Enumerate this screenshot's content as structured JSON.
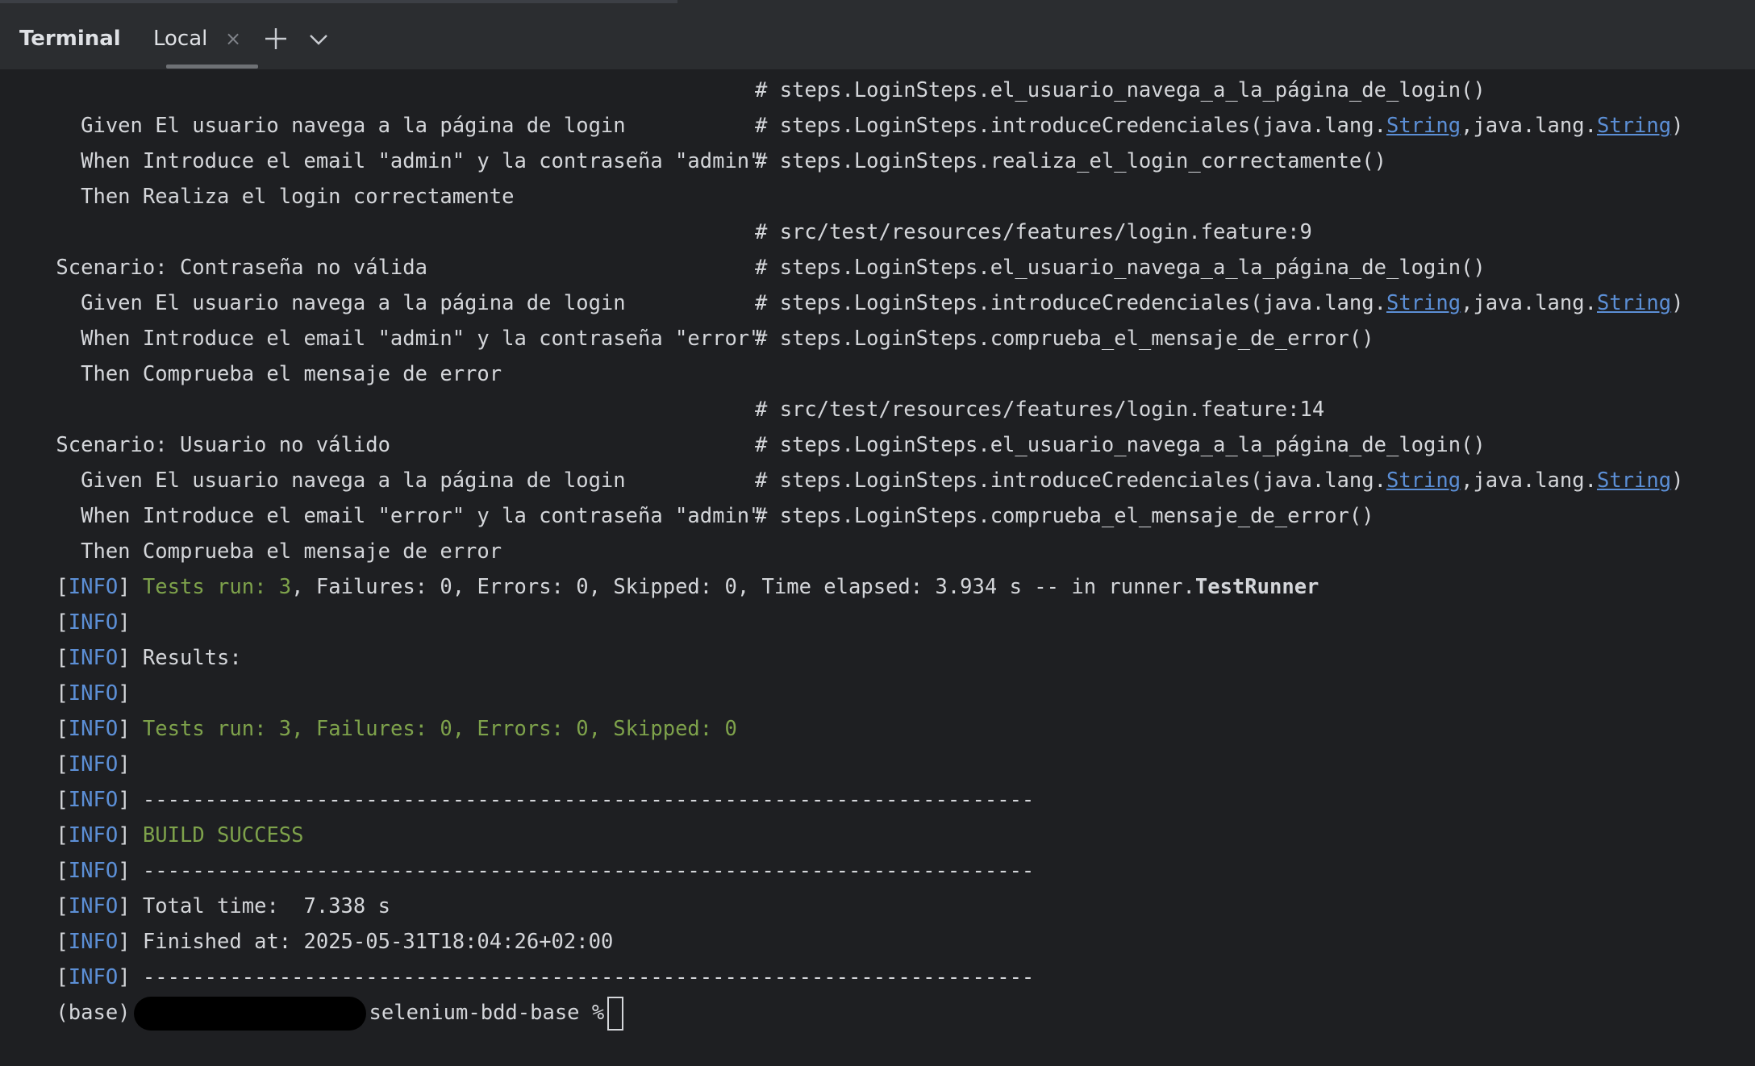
{
  "tabbar": {
    "title": "Terminal",
    "tab_label": "Local",
    "close_glyph": "×",
    "icons": {
      "close": "close-icon",
      "add": "plus-icon",
      "menu": "chevron-down-icon"
    }
  },
  "colors": {
    "green": "#7ea24b",
    "info": "#5c8fd6",
    "text": "#d4d6da",
    "background": "#1e1f22"
  },
  "output": {
    "s1": {
      "given": "  Given El usuario navega a la página de login",
      "given_ref": "# steps.LoginSteps.el_usuario_navega_a_la_página_de_login()",
      "when": "  When Introduce el email \"admin\" y la contraseña \"admin\"",
      "when_ref_pre": "# steps.LoginSteps.introduceCredenciales(java.lang.",
      "when_ref_link1": "String",
      "when_ref_mid": ",java.lang.",
      "when_ref_link2": "String",
      "when_ref_post": ")",
      "then": "  Then Realiza el login correctamente",
      "then_ref": "# steps.LoginSteps.realiza_el_login_correctamente()"
    },
    "s2": {
      "scenario": "Scenario: Contraseña no válida",
      "scenario_ref": "# src/test/resources/features/login.feature:9",
      "given": "  Given El usuario navega a la página de login",
      "given_ref": "# steps.LoginSteps.el_usuario_navega_a_la_página_de_login()",
      "when": "  When Introduce el email \"admin\" y la contraseña \"error\"",
      "when_ref_pre": "# steps.LoginSteps.introduceCredenciales(java.lang.",
      "when_ref_link1": "String",
      "when_ref_mid": ",java.lang.",
      "when_ref_link2": "String",
      "when_ref_post": ")",
      "then": "  Then Comprueba el mensaje de error",
      "then_ref": "# steps.LoginSteps.comprueba_el_mensaje_de_error()"
    },
    "s3": {
      "scenario": "Scenario: Usuario no válido",
      "scenario_ref": "# src/test/resources/features/login.feature:14",
      "given": "  Given El usuario navega a la página de login",
      "given_ref": "# steps.LoginSteps.el_usuario_navega_a_la_página_de_login()",
      "when": "  When Introduce el email \"error\" y la contraseña \"admin\"",
      "when_ref_pre": "# steps.LoginSteps.introduceCredenciales(java.lang.",
      "when_ref_link1": "String",
      "when_ref_mid": ",java.lang.",
      "when_ref_link2": "String",
      "when_ref_post": ")",
      "then": "  Then Comprueba el mensaje de error",
      "then_ref": "# steps.LoginSteps.comprueba_el_mensaje_de_error()"
    },
    "info": {
      "open": "[",
      "tag": "INFO",
      "close": "]"
    },
    "tests_run_line": {
      "green": " Tests run: 3",
      "rest_pre": ", Failures: 0, Errors: 0, Skipped: 0, Time elapsed: 3.934 s -- in runner.",
      "runner": "TestRunner"
    },
    "results": " Results:",
    "summary": " Tests run: 3, Failures: 0, Errors: 0, Skipped: 0",
    "separator": " ------------------------------------------------------------------------",
    "build": " BUILD SUCCESS",
    "total_time": " Total time:  7.338 s",
    "finished": " Finished at: 2025-05-31T18:04:26+02:00",
    "prompt": {
      "prefix": "(base)",
      "dir": "selenium-bdd-base %"
    }
  }
}
